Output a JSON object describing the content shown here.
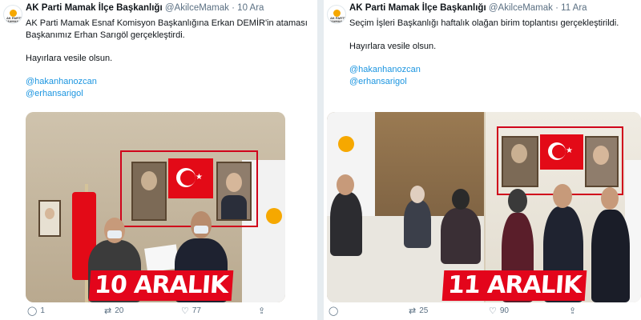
{
  "tweets": [
    {
      "account": {
        "name": "AK Parti Mamak İlçe Başkanlığı",
        "handle": "@AkilceMamak",
        "separator": "·",
        "date": "10 Ara"
      },
      "text_lines": [
        "AK Parti Mamak Esnaf Komisyon Başkanlığına Erkan DEMİR'in ataması",
        "Başkanımız Erhan Sarıgöl gerçekleştirdi."
      ],
      "closing": "Hayırlara vesile olsun.",
      "mentions": [
        "@hakanhanozcan",
        "@erhansarigol"
      ],
      "banner": "10 ARALIK",
      "actions": {
        "reply": "1",
        "retweet": "20",
        "like": "77"
      }
    },
    {
      "account": {
        "name": "AK Parti Mamak İlçe Başkanlığı",
        "handle": "@AkilceMamak",
        "separator": "·",
        "date": "11 Ara"
      },
      "text_lines": [
        "Seçim İşleri Başkanlığı haftalık olağan birim toplantısı gerçekleştirildi."
      ],
      "closing": "Hayırlara vesile olsun.",
      "mentions": [
        "@hakanhanozcan",
        "@erhansarigol"
      ],
      "banner": "11 ARALIK",
      "actions": {
        "reply": "",
        "retweet": "25",
        "like": "90"
      }
    }
  ],
  "logo": {
    "text": "AK PARTİ MAMAK"
  },
  "colors": {
    "mention": "#1b95e0",
    "banner": "#e3051b",
    "highlight_box": "#d0021b",
    "flag": "#e30a17"
  },
  "icons": {
    "reply": "reply-icon",
    "retweet": "retweet-icon",
    "like": "like-icon",
    "share": "share-icon"
  }
}
